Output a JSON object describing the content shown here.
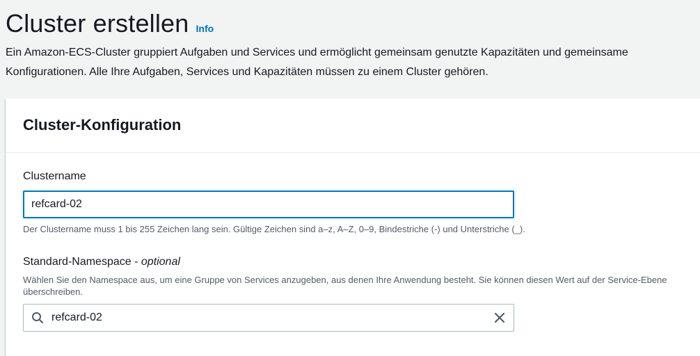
{
  "header": {
    "title": "Cluster erstellen",
    "info_label": "Info",
    "description_line1": "Ein Amazon-ECS-Cluster gruppiert Aufgaben und Services und ermöglicht gemeinsam genutzte Kapazitäten und gemeinsame",
    "description_line2": "Konfigurationen. Alle Ihre Aufgaben, Services und Kapazitäten müssen zu einem Cluster gehören."
  },
  "cluster_config": {
    "title": "Cluster-Konfiguration",
    "cluster_name": {
      "label": "Clustername",
      "value": "refcard-02",
      "constraint": "Der Clustername muss 1 bis 255 Zeichen lang sein. Gültige Zeichen sind a–z, A–Z, 0–9, Bindestriche (-) und Unterstriche (_)."
    },
    "namespace": {
      "label": "Standard-Namespace - ",
      "label_optional": "optional",
      "description": "Wählen Sie den Namespace aus, um eine Gruppe von Services anzugeben, aus denen Ihre Anwendung besteht. Sie können diesen Wert auf der Service-Ebene überschreiben.",
      "value": "refcard-02"
    }
  },
  "icons": {
    "search": "search-icon",
    "clear": "close-icon"
  },
  "colors": {
    "accent": "#0073bb",
    "background": "#f2f3f3",
    "text": "#16191f",
    "secondary_text": "#545b64"
  }
}
